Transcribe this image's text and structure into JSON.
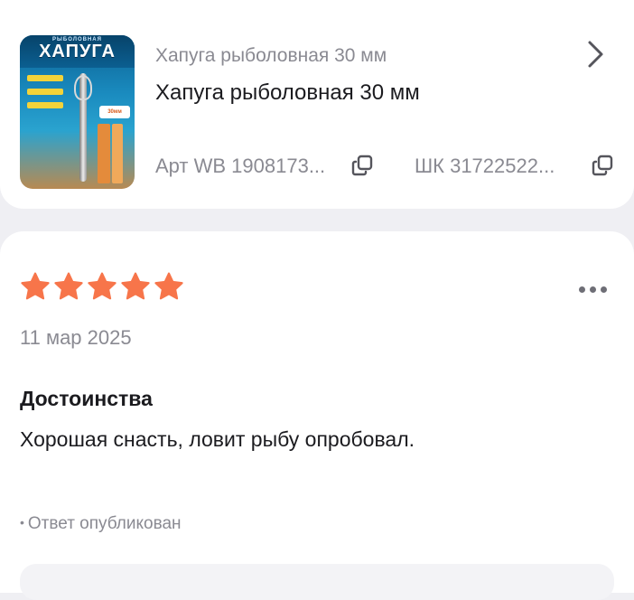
{
  "product": {
    "image_banner_small": "РЫБОЛОВНАЯ",
    "image_banner_big": "ХАПУГА",
    "image_size_badge": "30мм",
    "subtitle": "Хапуга рыболовная 30 мм",
    "title": "Хапуга рыболовная 30 мм",
    "article": "Арт WB 1908173...",
    "barcode": "ШК 31722522...",
    "chevron_icon": "chevron-right-icon",
    "copy_icon": "copy-icon"
  },
  "review": {
    "rating": 5,
    "rating_max": 5,
    "star_color": "#f7754a",
    "more_icon": "more-horizontal-icon",
    "date": "11 мар 2025",
    "section_title": "Достоинства",
    "text": "Хорошая снасть, ловит рыбу опробовал.",
    "answer_dot": "•",
    "answer_status": "Ответ опубликован"
  }
}
